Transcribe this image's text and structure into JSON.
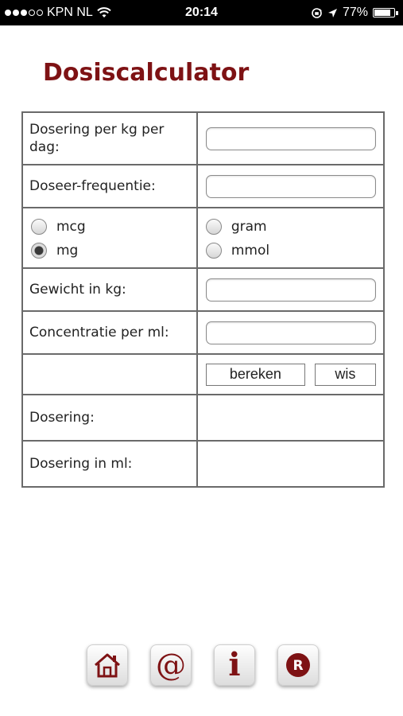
{
  "status_bar": {
    "carrier": "KPN NL",
    "time": "20:14",
    "battery": "77%",
    "signal_bars_filled": 3,
    "signal_bars_total": 5
  },
  "page": {
    "title": "Dosiscalculator"
  },
  "form": {
    "dose_per_kg_label": "Dosering per kg per dag:",
    "dose_per_kg_value": "",
    "frequency_label": "Doseer-frequentie:",
    "frequency_value": "",
    "units_left": [
      {
        "label": "mcg",
        "checked": false
      },
      {
        "label": "mg",
        "checked": true
      }
    ],
    "units_right": [
      {
        "label": "gram",
        "checked": false
      },
      {
        "label": "mmol",
        "checked": false
      }
    ],
    "weight_label": "Gewicht in kg:",
    "weight_value": "",
    "concentration_label": "Concentratie per ml:",
    "concentration_value": "",
    "calculate_label": "bereken",
    "clear_label": "wis",
    "dose_result_label": "Dosering:",
    "dose_result_value": "",
    "dose_ml_label": "Dosering in ml:",
    "dose_ml_value": ""
  },
  "toolbar": {
    "icons": [
      "home-icon",
      "at-sign-icon",
      "info-icon",
      "registered-icon"
    ]
  },
  "colors": {
    "accent": "#7e1214",
    "border": "#6a6a6a"
  }
}
